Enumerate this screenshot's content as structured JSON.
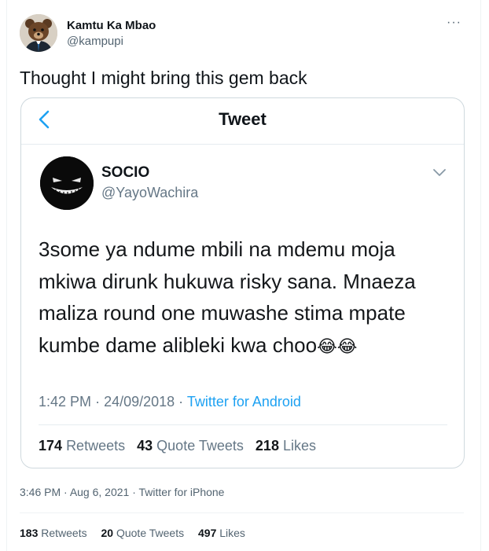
{
  "author": {
    "name": "Kamtu Ka Mbao",
    "handle": "@kampupi"
  },
  "more_label": "···",
  "tweet_text": "Thought I might bring this gem back",
  "embedded": {
    "header_title": "Tweet",
    "author_name": "SOCIO",
    "author_handle": "@YayoWachira",
    "text_lines": [
      "3some ya ndume mbili na mdemu moja",
      "mkiwa dirunk hukuwa risky sana. Mnaeza",
      "maliza round one muwashe stima mpate",
      "kumbe dame alibleki kwa choo"
    ],
    "emoji": "😂😂",
    "time": "1:42 PM",
    "date": "24/09/2018",
    "source": "Twitter for Android",
    "stats": {
      "retweets_count": "174",
      "retweets_label": "Retweets",
      "quotes_count": "43",
      "quotes_label": "Quote Tweets",
      "likes_count": "218",
      "likes_label": "Likes"
    }
  },
  "meta": {
    "time": "3:46 PM",
    "date": "Aug 6, 2021",
    "source": "Twitter for iPhone"
  },
  "stats": {
    "retweets_count": "183",
    "retweets_label": "Retweets",
    "quotes_count": "20",
    "quotes_label": "Quote Tweets",
    "likes_count": "497",
    "likes_label": "Likes"
  },
  "colors": {
    "link": "#1da1f2",
    "secondary_text": "#536471"
  }
}
